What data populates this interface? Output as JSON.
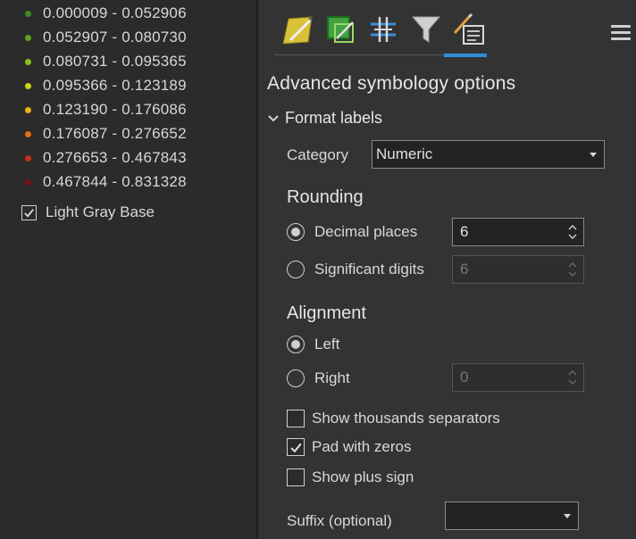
{
  "legend": {
    "items": [
      {
        "label": "0.000009 - 0.052906",
        "color": "#3e8e1e"
      },
      {
        "label": "0.052907 - 0.080730",
        "color": "#5aa51c"
      },
      {
        "label": "0.080731 - 0.095365",
        "color": "#8cc21a"
      },
      {
        "label": "0.095366 - 0.123189",
        "color": "#c8d818"
      },
      {
        "label": "0.123190 - 0.176086",
        "color": "#e6b312"
      },
      {
        "label": "0.176087 - 0.276652",
        "color": "#e36f10"
      },
      {
        "label": "0.276653 - 0.467843",
        "color": "#c7301a"
      },
      {
        "label": "0.467844 - 0.831328",
        "color": "#7a1212"
      }
    ],
    "basemap": {
      "label": "Light Gray Base",
      "checked": true
    }
  },
  "toolbar": {
    "tabs": [
      {
        "icon": "primary-symbology-icon"
      },
      {
        "icon": "vary-symbology-icon"
      },
      {
        "icon": "symbol-layers-icon"
      },
      {
        "icon": "filter-icon"
      },
      {
        "icon": "advanced-symbology-icon",
        "active": true
      }
    ],
    "accent_color": "#2e8fd8"
  },
  "panel": {
    "heading": "Advanced symbology options",
    "section": "Format labels",
    "category_label": "Category",
    "category_value": "Numeric",
    "rounding": {
      "title": "Rounding",
      "decimal_label": "Decimal places",
      "decimal_value": "6",
      "significant_label": "Significant digits",
      "significant_value": "6"
    },
    "alignment": {
      "title": "Alignment",
      "left_label": "Left",
      "right_label": "Right",
      "right_value": "0"
    },
    "checks": {
      "thousands": "Show thousands separators",
      "pad": "Pad with zeros",
      "plus": "Show plus sign"
    },
    "suffix_label": "Suffix (optional)"
  }
}
